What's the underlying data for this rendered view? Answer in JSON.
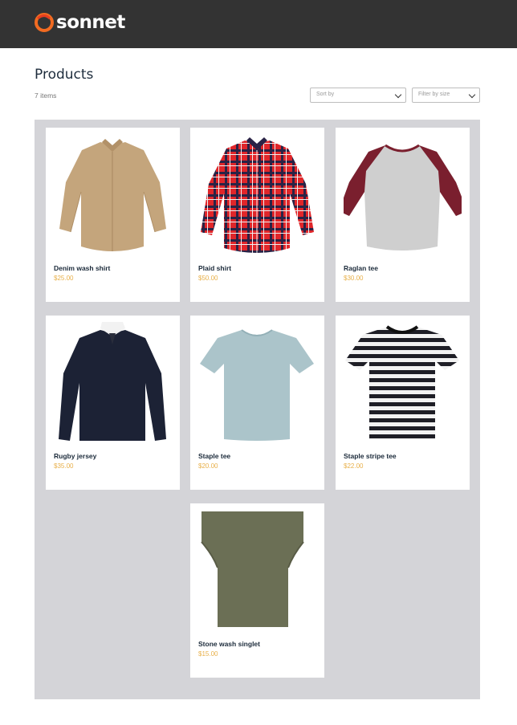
{
  "brand": {
    "name": "sonnet"
  },
  "page": {
    "title": "Products",
    "item_count": "7 items"
  },
  "controls": {
    "sort_placeholder": "Sort by",
    "filter_placeholder": "Filter by size"
  },
  "products": [
    {
      "name": "Denim wash shirt",
      "price": "$25.00",
      "image": "tan-button-shirt"
    },
    {
      "name": "Plaid shirt",
      "price": "$50.00",
      "image": "red-plaid-shirt"
    },
    {
      "name": "Raglan tee",
      "price": "$30.00",
      "image": "raglan-tee"
    },
    {
      "name": "Rugby jersey",
      "price": "$35.00",
      "image": "navy-rugby-jersey"
    },
    {
      "name": "Staple tee",
      "price": "$20.00",
      "image": "light-blue-tee"
    },
    {
      "name": "Staple stripe tee",
      "price": "$22.00",
      "image": "stripe-tee"
    },
    {
      "name": "Stone wash singlet",
      "price": "$15.00",
      "image": "olive-singlet"
    }
  ],
  "colors": {
    "header_bg": "#333333",
    "grid_bg": "#d4d4d8",
    "price": "#e8b04a",
    "logo_orange": "#f26b21"
  }
}
